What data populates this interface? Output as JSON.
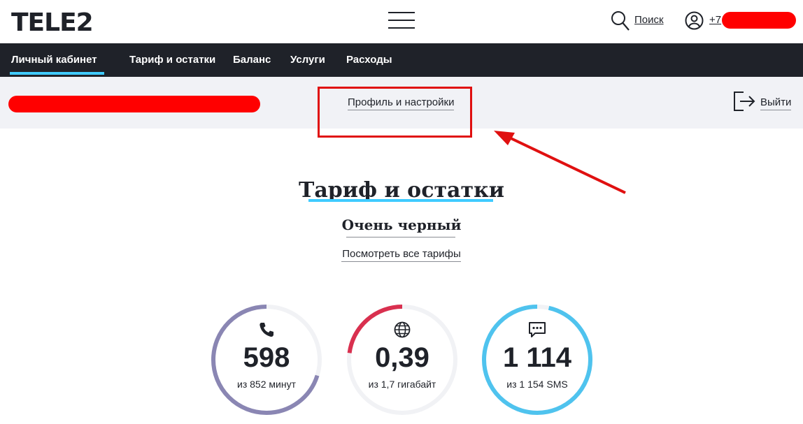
{
  "header": {
    "logo": "TELE2",
    "search_label": "Поиск",
    "phone_prefix": "+7"
  },
  "nav": {
    "items": [
      {
        "label": "Личный кабинет",
        "active": true
      },
      {
        "label": "Тариф и остатки",
        "active": false
      },
      {
        "label": "Баланс",
        "active": false
      },
      {
        "label": "Услуги",
        "active": false
      },
      {
        "label": "Расходы",
        "active": false
      }
    ]
  },
  "subbar": {
    "profile_link": "Профиль и настройки",
    "exit_label": "Выйти"
  },
  "main": {
    "title": "Тариф и остатки",
    "tariff_name": "Очень черный",
    "all_tariffs_link": "Посмотреть все тарифы"
  },
  "remains": [
    {
      "icon": "phone-icon",
      "value": "598",
      "label": "из 852 минут",
      "fraction": 0.702,
      "color": "#8a86b3"
    },
    {
      "icon": "globe-icon",
      "value": "0,39",
      "label": "из 1,7 гигабайт",
      "fraction": 0.23,
      "color": "#d9304f"
    },
    {
      "icon": "chat-icon",
      "value": "1 114",
      "label": "из 1 154 SMS",
      "fraction": 0.965,
      "color": "#4fc3ee"
    }
  ],
  "colors": {
    "brand_dark": "#1f2229",
    "accent": "#3fcbff",
    "annotation": "#e01010",
    "redaction": "#ff0000"
  }
}
